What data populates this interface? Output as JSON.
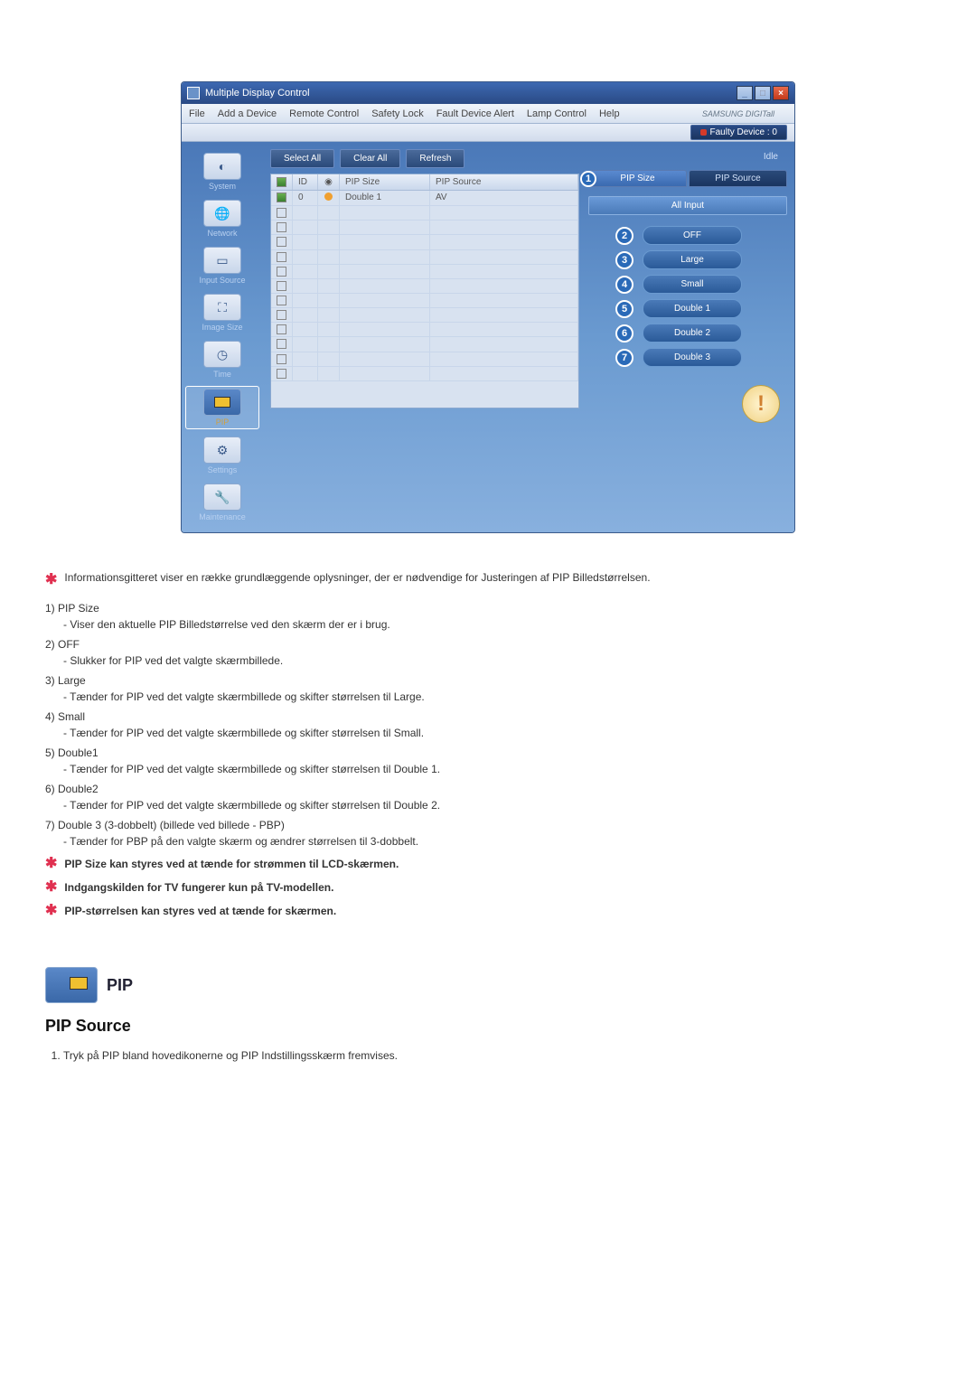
{
  "app": {
    "title": "Multiple Display Control",
    "menu": [
      "File",
      "Add a Device",
      "Remote Control",
      "Safety Lock",
      "Fault Device Alert",
      "Lamp Control",
      "Help"
    ],
    "brand": "SAMSUNG DIGITall",
    "fault": "Faulty Device : 0",
    "idle": "Idle",
    "buttons": {
      "selectAll": "Select All",
      "clearAll": "Clear All",
      "refresh": "Refresh"
    },
    "nav": [
      "System",
      "Network",
      "Input Source",
      "Image Size",
      "Time",
      "PIP",
      "Settings",
      "Maintenance"
    ],
    "gridHead": {
      "id": "ID",
      "pipSize": "PIP Size",
      "pipSource": "PIP Source"
    },
    "gridRow": {
      "id": "0",
      "pipSize": "Double 1",
      "pipSource": "AV"
    },
    "tabs": {
      "size": "PIP Size",
      "source": "PIP Source"
    },
    "allInput": "All Input",
    "opts": [
      "OFF",
      "Large",
      "Small",
      "Double 1",
      "Double 2",
      "Double 3"
    ]
  },
  "doc": {
    "intro": "Informationsgitteret viser en række grundlæggende oplysninger, der er nødvendige for Justeringen af PIP Billedstørrelsen.",
    "items": [
      {
        "n": "1)",
        "t": "PIP Size",
        "d": "- Viser den aktuelle PIP Billedstørrelse ved den skærm der er i brug."
      },
      {
        "n": "2)",
        "t": "OFF",
        "d": "- Slukker for PIP ved det valgte skærmbillede."
      },
      {
        "n": "3)",
        "t": "Large",
        "d": "- Tænder for PIP ved det valgte skærmbillede og skifter størrelsen til Large."
      },
      {
        "n": "4)",
        "t": "Small",
        "d": "- Tænder for PIP ved det valgte skærmbillede og skifter størrelsen til Small."
      },
      {
        "n": "5)",
        "t": "Double1",
        "d": "- Tænder for PIP ved det valgte skærmbillede og skifter størrelsen til Double 1."
      },
      {
        "n": "6)",
        "t": "Double2",
        "d": "- Tænder for PIP ved det valgte skærmbillede og skifter størrelsen til Double 2."
      },
      {
        "n": "7)",
        "t": "Double 3 (3-dobbelt) (billede ved billede - PBP)",
        "d": "- Tænder for PBP på den valgte skærm og ændrer størrelsen til 3-dobbelt."
      }
    ],
    "notes": [
      "PIP Size kan styres ved at tænde for strømmen til LCD-skærmen.",
      "Indgangskilden for TV fungerer kun på TV-modellen.",
      "PIP-størrelsen kan styres ved at tænde for skærmen."
    ],
    "pipBand": "PIP",
    "h3": "PIP Source",
    "step1": "Tryk på PIP bland hovedikonerne og PIP Indstillingsskærm fremvises."
  }
}
